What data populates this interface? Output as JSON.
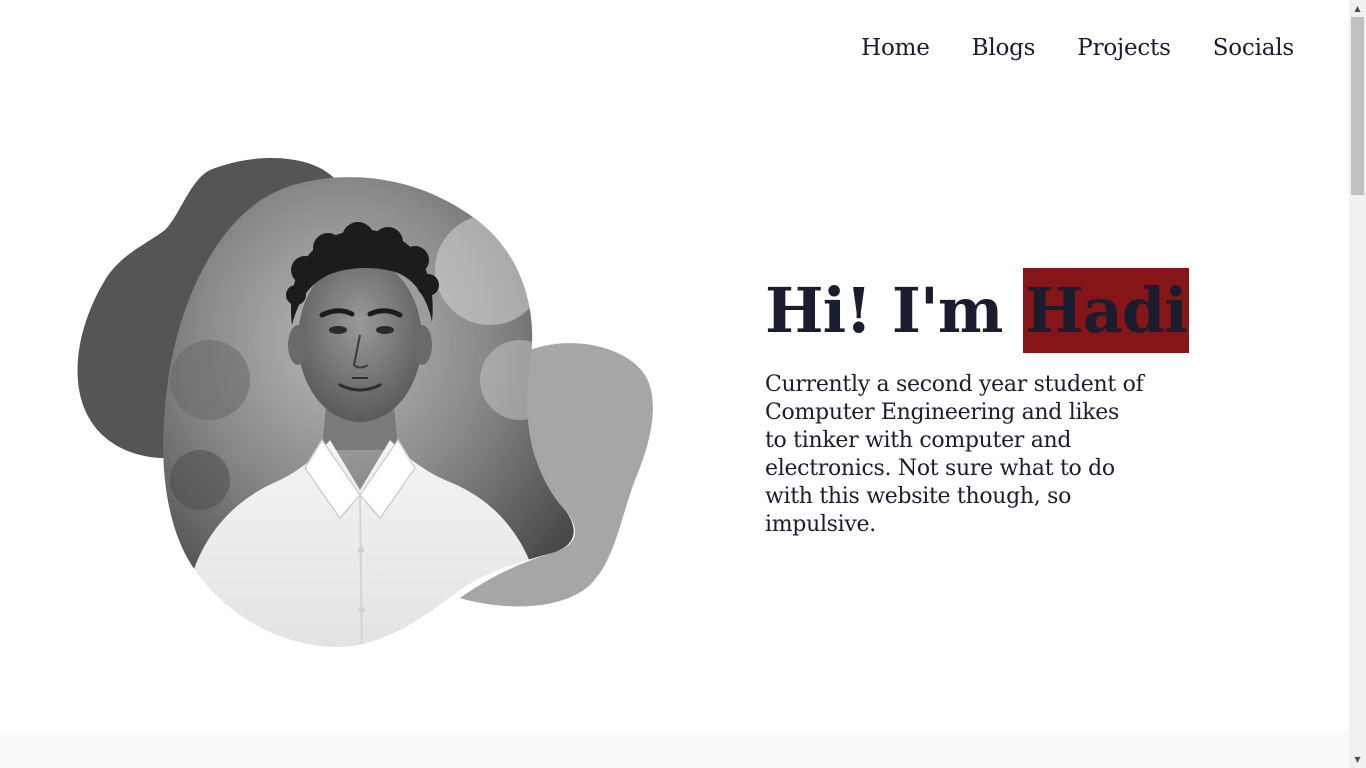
{
  "nav": {
    "items": [
      "Home",
      "Blogs",
      "Projects",
      "Socials"
    ]
  },
  "hero": {
    "greeting_prefix": "Hi! I'm",
    "name": "Hadi",
    "description": "Currently a second year student of Computer Engineering and likes to tinker with computer and electronics. Not sure what to do with this website though, so impulsive."
  },
  "colors": {
    "text": "#1a1d2e",
    "highlight": "#861517",
    "blob_dark": "#555555",
    "blob_light": "#a6a6a6"
  },
  "scrollbar": {
    "up_icon": "▲",
    "down_icon": "▼"
  }
}
